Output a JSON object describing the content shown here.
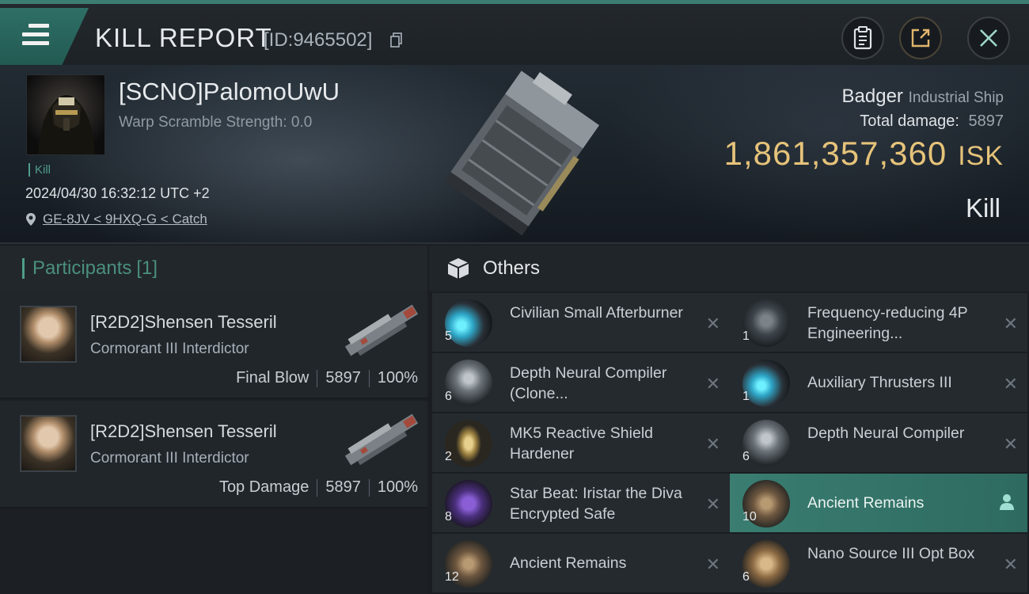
{
  "header": {
    "title": "KILL REPORT",
    "report_id": "[ID:9465502]"
  },
  "victim": {
    "name": "[SCNO]PalomoUwU",
    "warp_scramble": "Warp Scramble Strength: 0.0",
    "kill_tag": "Kill",
    "timestamp": "2024/04/30 16:32:12 UTC +2",
    "location": "GE-8JV < 9HXQ-G < Catch",
    "ship": "Badger",
    "ship_class": "Industrial Ship",
    "total_damage_label": "Total damage:",
    "total_damage": "5897",
    "isk_value": "1,861,357,360",
    "isk_unit": "ISK",
    "result": "Kill"
  },
  "participants": {
    "label": "Participants",
    "count": "[1]",
    "rows": [
      {
        "name": "[R2D2]Shensen Tesseril",
        "ship": "Cormorant III Interdictor",
        "role": "Final Blow",
        "damage": "5897",
        "percent": "100%"
      },
      {
        "name": "[R2D2]Shensen Tesseril",
        "ship": "Cormorant III Interdictor",
        "role": "Top Damage",
        "damage": "5897",
        "percent": "100%"
      }
    ]
  },
  "others": {
    "label": "Others",
    "items": [
      {
        "qty": "5",
        "name": "Civilian Small Afterburner",
        "icon": "afterburner-icon"
      },
      {
        "qty": "1",
        "name": "Frequency-reducing 4P Engineering...",
        "icon": "engineering-module-icon"
      },
      {
        "qty": "6",
        "name": "Depth Neural Compiler (Clone...",
        "icon": "neural-compiler-icon"
      },
      {
        "qty": "1",
        "name": "Auxiliary Thrusters III",
        "icon": "thruster-icon"
      },
      {
        "qty": "2",
        "name": "MK5 Reactive Shield Hardener",
        "icon": "shield-hardener-icon"
      },
      {
        "qty": "6",
        "name": "Depth Neural Compiler",
        "icon": "neural-compiler-icon"
      },
      {
        "qty": "8",
        "name": "Star Beat: Iristar the Diva Encrypted Safe",
        "icon": "encrypted-safe-icon"
      },
      {
        "qty": "10",
        "name": "Ancient Remains",
        "icon": "ancient-remains-icon"
      },
      {
        "qty": "12",
        "name": "Ancient Remains",
        "icon": "ancient-remains-icon"
      },
      {
        "qty": "6",
        "name": "Nano Source III Opt Box",
        "icon": "nano-box-icon"
      }
    ]
  },
  "colors": {
    "accent": "#3a7d71",
    "isk_gold": "#e6c37a",
    "kill_green": "#4f9e8a"
  }
}
